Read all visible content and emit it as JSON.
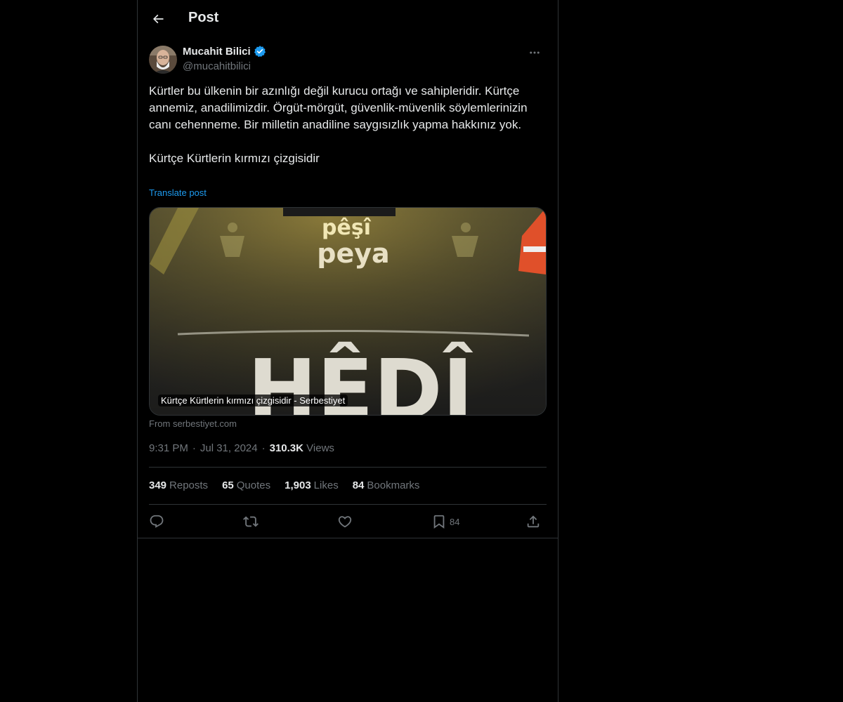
{
  "header": {
    "title": "Post"
  },
  "author": {
    "display_name": "Mucahit Bilici",
    "handle": "@mucahitbilici",
    "verified": true
  },
  "post": {
    "text": "Kürtler bu ülkenin bir azınlığı değil kurucu ortağı ve sahipleridir. Kürtçe annemiz, anadilimizdir. Örgüt-mörgüt, güvenlik-müvenlik söylemlerinizin canı cehenneme. Bir milletin anadiline saygısızlık yapma hakkınız yok.\n\nKürtçe Kürtlerin kırmızı çizgisidir",
    "translate_label": "Translate post"
  },
  "card": {
    "caption": "Kürtçe Kürtlerin kırmızı çizgisidir - Serbestiyet",
    "source": "From serbestiyet.com",
    "image_text": {
      "line1": "pêşî",
      "line2": "peya",
      "big": "HÊDÎ"
    }
  },
  "meta": {
    "time": "9:31 PM",
    "date": "Jul 31, 2024",
    "views_count": "310.3K",
    "views_label": "Views",
    "separator": "·"
  },
  "stats": [
    {
      "count": "349",
      "label": "Reposts"
    },
    {
      "count": "65",
      "label": "Quotes"
    },
    {
      "count": "1,903",
      "label": "Likes"
    },
    {
      "count": "84",
      "label": "Bookmarks"
    }
  ],
  "actions": {
    "bookmark_count": "84"
  },
  "colors": {
    "accent": "#1d9bf0",
    "text": "#e7e9ea",
    "muted": "#71767b",
    "border": "#2f3336",
    "background": "#000000"
  }
}
